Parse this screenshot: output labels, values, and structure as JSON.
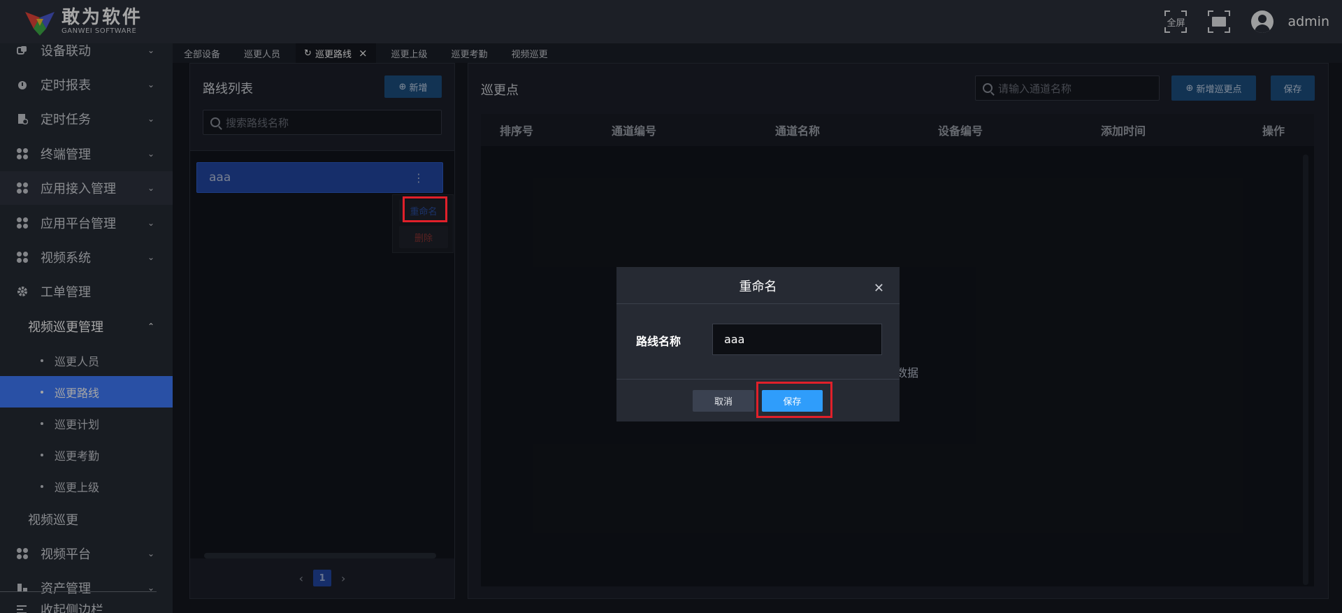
{
  "header": {
    "logo_cn": "敢为软件",
    "logo_en": "GANWEI SOFTWARE",
    "fullscreen_label": "全屏",
    "username": "admin"
  },
  "sidebar": {
    "items": [
      {
        "label": "设备联动",
        "icon": "link-icon"
      },
      {
        "label": "定时报表",
        "icon": "clock-icon"
      },
      {
        "label": "定时任务",
        "icon": "task-icon"
      },
      {
        "label": "终端管理",
        "icon": "grid-icon"
      },
      {
        "label": "应用接入管理",
        "icon": "grid-icon"
      },
      {
        "label": "应用平台管理",
        "icon": "grid-icon"
      },
      {
        "label": "视频系统",
        "icon": "grid-icon"
      },
      {
        "label": "工单管理",
        "icon": "gear-icon"
      }
    ],
    "open_group": "视频巡更管理",
    "sub_items": [
      "巡更人员",
      "巡更路线",
      "巡更计划",
      "巡更考勤",
      "巡更上级"
    ],
    "after_items": [
      {
        "label": "视频巡更"
      },
      {
        "label": "视频平台"
      },
      {
        "label": "资产管理"
      }
    ],
    "collapse_label": "收起侧边栏"
  },
  "tabs": [
    "全部设备",
    "巡更人员",
    "巡更路线",
    "巡更上级",
    "巡更考勤",
    "视频巡更"
  ],
  "left_panel": {
    "title": "路线列表",
    "add_button": "新增",
    "search_placeholder": "搜索路线名称",
    "routes": [
      "aaa"
    ],
    "current_page": "1"
  },
  "context_menu": {
    "rename": "重命名",
    "delete": "删除"
  },
  "right_panel": {
    "title": "巡更点",
    "search_placeholder": "请输入通道名称",
    "add_button": "新增巡更点",
    "save_button": "保存",
    "columns": [
      "排序号",
      "通道编号",
      "通道名称",
      "设备编号",
      "添加时间",
      "操作"
    ],
    "empty_text": "数据"
  },
  "dialog": {
    "title": "重命名",
    "field_label": "路线名称",
    "field_value": "aaa",
    "cancel": "取消",
    "save": "保存"
  }
}
